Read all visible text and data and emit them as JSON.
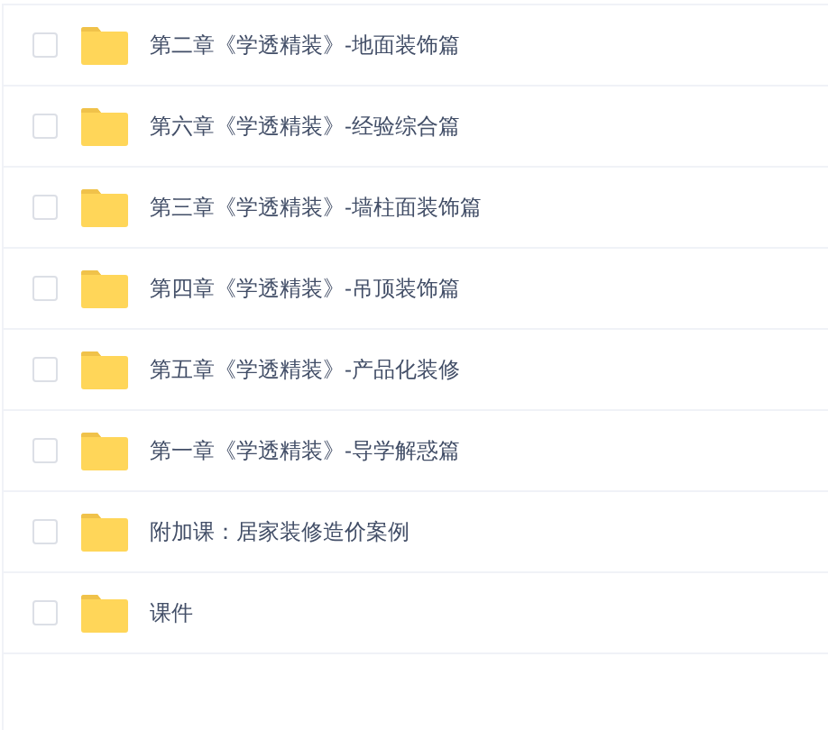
{
  "files": [
    {
      "name": "第二章《学透精装》-地面装饰篇",
      "checked": false
    },
    {
      "name": "第六章《学透精装》-经验综合篇",
      "checked": false
    },
    {
      "name": "第三章《学透精装》-墙柱面装饰篇",
      "checked": false
    },
    {
      "name": "第四章《学透精装》-吊顶装饰篇",
      "checked": false
    },
    {
      "name": "第五章《学透精装》-产品化装修",
      "checked": false
    },
    {
      "name": "第一章《学透精装》-导学解惑篇",
      "checked": false
    },
    {
      "name": "附加课：居家装修造价案例",
      "checked": false
    },
    {
      "name": "课件",
      "checked": false
    }
  ]
}
